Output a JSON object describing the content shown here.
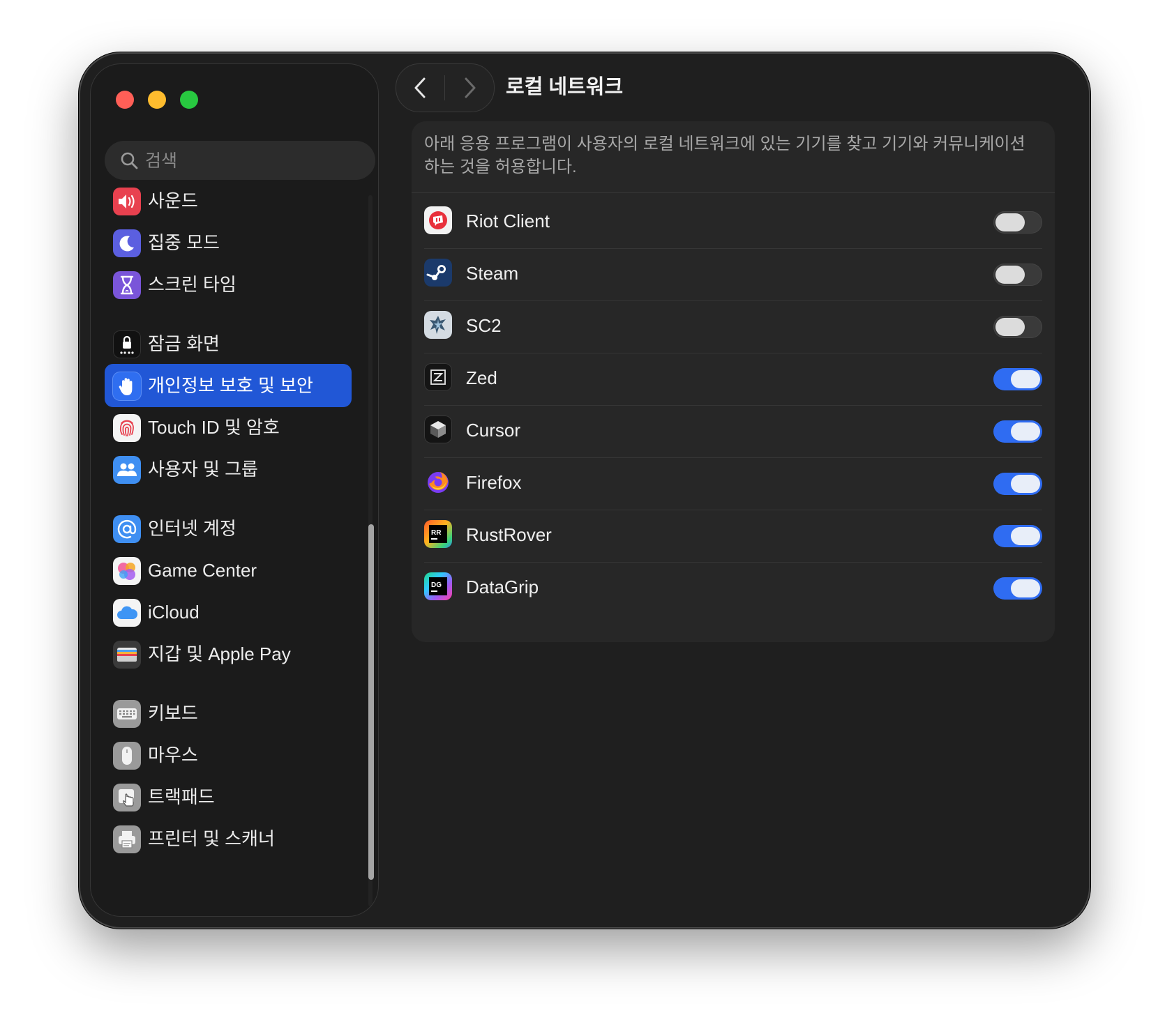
{
  "window": {
    "title": "로컬 네트워크"
  },
  "search": {
    "placeholder": "검색"
  },
  "sidebar": {
    "items": [
      {
        "label": "사운드",
        "icon": "speaker-icon",
        "color": "#e8414f"
      },
      {
        "label": "집중 모드",
        "icon": "moon-icon",
        "color": "#5b5fe0"
      },
      {
        "label": "스크린 타임",
        "icon": "hourglass-icon",
        "color": "#7a55d9"
      },
      {
        "label": "잠금 화면",
        "icon": "lock-icon",
        "color": "#111111"
      },
      {
        "label": "개인정보 보호 및 보안",
        "icon": "hand-icon",
        "color": "#2f6ef0",
        "selected": true
      },
      {
        "label": "Touch ID 및 암호",
        "icon": "fingerprint-icon",
        "color": "#f4f4f4"
      },
      {
        "label": "사용자 및 그룹",
        "icon": "users-icon",
        "color": "#3f8ff2"
      },
      {
        "label": "인터넷 계정",
        "icon": "at-icon",
        "color": "#3f8ff2"
      },
      {
        "label": "Game Center",
        "icon": "game-center-icon",
        "color": "#f4f4f4"
      },
      {
        "label": "iCloud",
        "icon": "cloud-icon",
        "color": "#f4f4f4"
      },
      {
        "label": "지갑 및 Apple Pay",
        "icon": "wallet-icon",
        "color": "#3a3a3a"
      },
      {
        "label": "키보드",
        "icon": "keyboard-icon",
        "color": "#9a9a9a"
      },
      {
        "label": "마우스",
        "icon": "mouse-icon",
        "color": "#9a9a9a"
      },
      {
        "label": "트랙패드",
        "icon": "trackpad-icon",
        "color": "#9a9a9a"
      },
      {
        "label": "프린터 및 스캐너",
        "icon": "printer-icon",
        "color": "#9a9a9a"
      }
    ]
  },
  "panel": {
    "description": "아래 응용 프로그램이 사용자의 로컬 네트워크에 있는 기기를 찾고 기기와 커뮤니케이션하는 것을 허용합니다.",
    "apps": [
      {
        "name": "Riot Client",
        "enabled": false,
        "icon": "riot-client-icon"
      },
      {
        "name": "Steam",
        "enabled": false,
        "icon": "steam-icon"
      },
      {
        "name": "SC2",
        "enabled": false,
        "icon": "sc2-icon"
      },
      {
        "name": "Zed",
        "enabled": true,
        "icon": "zed-icon"
      },
      {
        "name": "Cursor",
        "enabled": true,
        "icon": "cursor-icon"
      },
      {
        "name": "Firefox",
        "enabled": true,
        "icon": "firefox-icon"
      },
      {
        "name": "RustRover",
        "enabled": true,
        "icon": "rustrover-icon"
      },
      {
        "name": "DataGrip",
        "enabled": true,
        "icon": "datagrip-icon"
      }
    ]
  },
  "colors": {
    "accent": "#2f6cf2",
    "selection": "#2157d6",
    "background": "#1f1f1f"
  }
}
